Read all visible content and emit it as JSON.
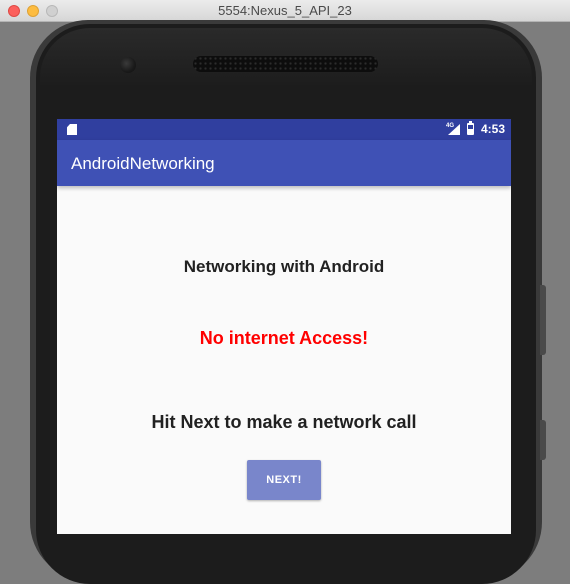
{
  "window": {
    "title": "5554:Nexus_5_API_23"
  },
  "status_bar": {
    "network_type": "4G",
    "time": "4:53",
    "icons": [
      "sd-card-icon",
      "signal-icon",
      "battery-icon"
    ]
  },
  "app_bar": {
    "title": "AndroidNetworking"
  },
  "main": {
    "heading": "Networking with Android",
    "status_message": "No internet Access!",
    "instruction": "Hit Next to make a network call",
    "next_label": "NEXT!"
  },
  "colors": {
    "status_bar": "#303f9f",
    "app_bar": "#3f51b5",
    "error_text": "#ff0000",
    "button": "#7986cb",
    "window_close": "#fc605c",
    "window_minimize": "#fdbc40"
  }
}
